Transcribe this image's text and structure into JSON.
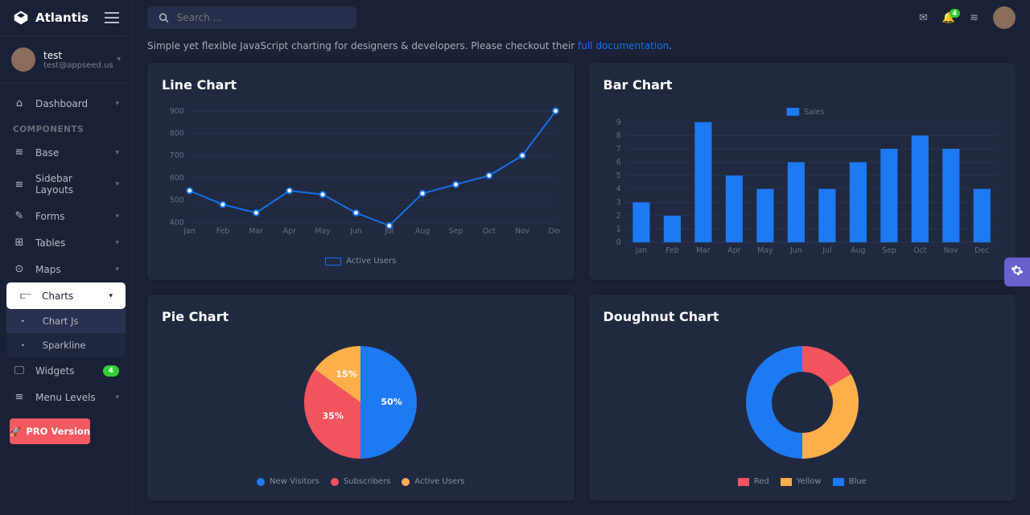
{
  "brand": "Atlantis",
  "user": {
    "name": "test",
    "email": "test@appseed.us"
  },
  "search": {
    "placeholder": "Search ..."
  },
  "sidebar": {
    "dash": "Dashboard",
    "section": "COMPONENTS",
    "items": {
      "base": "Base",
      "layouts": "Sidebar Layouts",
      "forms": "Forms",
      "tables": "Tables",
      "maps": "Maps",
      "charts": "Charts",
      "chartjs": "Chart Js",
      "sparkline": "Sparkline",
      "widgets": "Widgets",
      "widgets_badge": "4",
      "menulevels": "Menu Levels"
    },
    "pro": "PRO Version"
  },
  "subtitle": {
    "pre": "Simple yet flexible JavaScript charting for designers & developers. Please checkout their ",
    "link": "full documentation"
  },
  "top": {
    "bell_count": "4"
  },
  "cards": {
    "line": "Line Chart",
    "bar": "Bar Chart",
    "pie": "Pie Chart",
    "doughnut": "Doughnut Chart"
  },
  "chart_data": [
    {
      "type": "line",
      "title": "Line Chart",
      "categories": [
        "Jan",
        "Feb",
        "Mar",
        "Apr",
        "May",
        "Jun",
        "Jul",
        "Aug",
        "Sep",
        "Oct",
        "Nov",
        "Dec"
      ],
      "series": [
        {
          "name": "Active Users",
          "values": [
            542,
            480,
            443,
            542,
            525,
            443,
            385,
            530,
            570,
            610,
            700,
            900
          ]
        }
      ],
      "ylim": [
        400,
        900
      ],
      "yticks": [
        400,
        500,
        600,
        700,
        800,
        900
      ]
    },
    {
      "type": "bar",
      "title": "Bar Chart",
      "categories": [
        "Jan",
        "Feb",
        "Mar",
        "Apr",
        "May",
        "Jun",
        "Jul",
        "Aug",
        "Sep",
        "Oct",
        "Nov",
        "Dec"
      ],
      "series": [
        {
          "name": "Sales",
          "values": [
            3,
            2,
            9,
            5,
            4,
            6,
            4,
            6,
            7,
            8,
            7,
            4
          ]
        }
      ],
      "ylim": [
        0,
        9
      ],
      "yticks": [
        0,
        1,
        2,
        3,
        4,
        5,
        6,
        7,
        8,
        9
      ]
    },
    {
      "type": "pie",
      "title": "Pie Chart",
      "labels": [
        "New Visitors",
        "Subscribers",
        "Active Users"
      ],
      "values": [
        50,
        35,
        15
      ],
      "colors": [
        "#1d7af3",
        "#f3545d",
        "#fdaf4b"
      ],
      "percent_labels": [
        "50%",
        "35%",
        "15%"
      ]
    },
    {
      "type": "doughnut",
      "title": "Doughnut Chart",
      "labels": [
        "Red",
        "Yellow",
        "Blue"
      ],
      "values": [
        10,
        20,
        30
      ],
      "colors": [
        "#f3545d",
        "#fdaf4b",
        "#1d7af3"
      ]
    }
  ]
}
